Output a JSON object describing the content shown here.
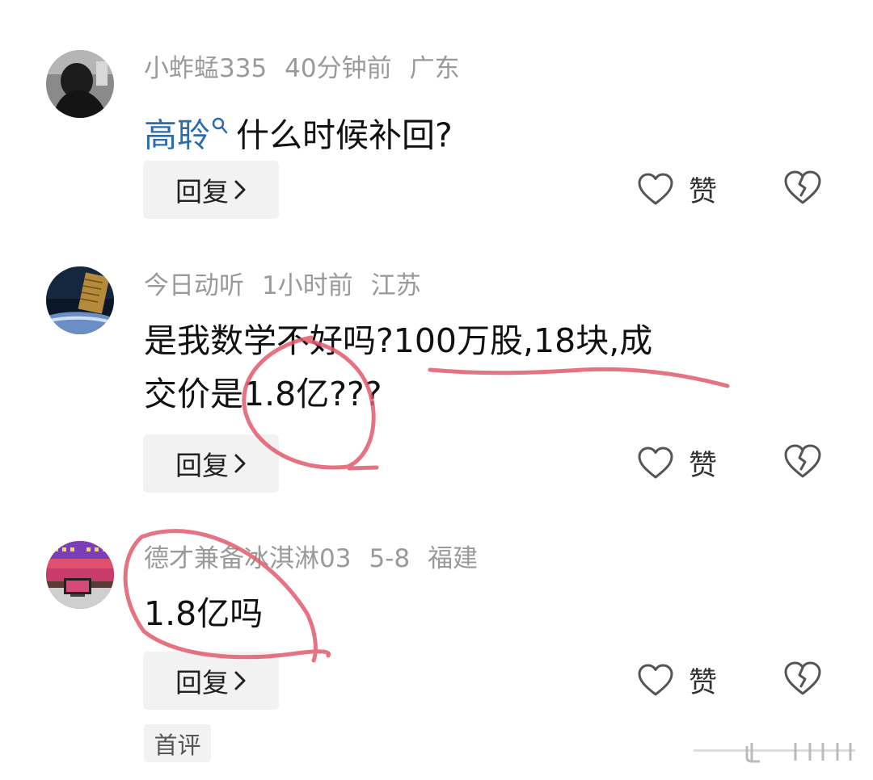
{
  "comments": [
    {
      "username": "小蚱蜢335",
      "time": "40分钟前",
      "location": "广东",
      "mention": "高聆",
      "text": "什么时候补回?",
      "reply_label": "回复",
      "like_label": "赞"
    },
    {
      "username": "今日动听",
      "time": "1小时前",
      "location": "江苏",
      "line1": "是我数学不好吗?100万股,18块,成",
      "line2": "交价是1.8亿???",
      "reply_label": "回复",
      "like_label": "赞"
    },
    {
      "username": "德才兼备冰淇淋03",
      "time": "5-8",
      "location": "福建",
      "text": "1.8亿吗",
      "reply_label": "回复",
      "like_label": "赞",
      "badge": "首评"
    }
  ],
  "icons": {
    "mention": "search-icon",
    "reply_chevron": "chevron-right-icon",
    "like": "heart-outline-icon",
    "dislike": "broken-heart-icon"
  },
  "colors": {
    "mention": "#2b6cb0",
    "meta": "#9a9a9a",
    "scribble": "#e15a6b",
    "button_bg": "#f2f2f2"
  }
}
